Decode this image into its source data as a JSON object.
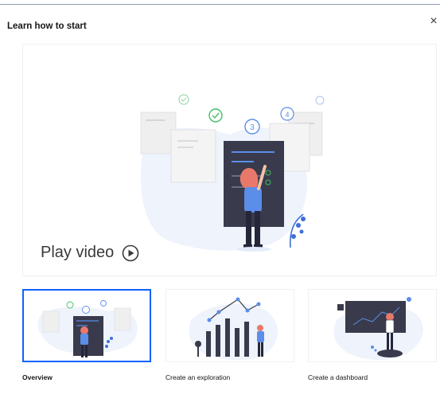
{
  "dialog": {
    "title": "Learn how to start",
    "close_glyph": "×"
  },
  "video": {
    "play_label": "Play video",
    "play_icon": "play-circle-icon",
    "step_numbers": [
      "3",
      "4"
    ]
  },
  "tutorials": [
    {
      "label": "Overview",
      "selected": true
    },
    {
      "label": "Create an exploration",
      "selected": false
    },
    {
      "label": "Create a dashboard",
      "selected": false
    }
  ],
  "colors": {
    "accent": "#0f62fe",
    "screen_dark": "#393a4c",
    "hair": "#e8796a",
    "shirt": "#5a8ee8",
    "blob": "#eef3fc",
    "check_green": "#42be65"
  }
}
